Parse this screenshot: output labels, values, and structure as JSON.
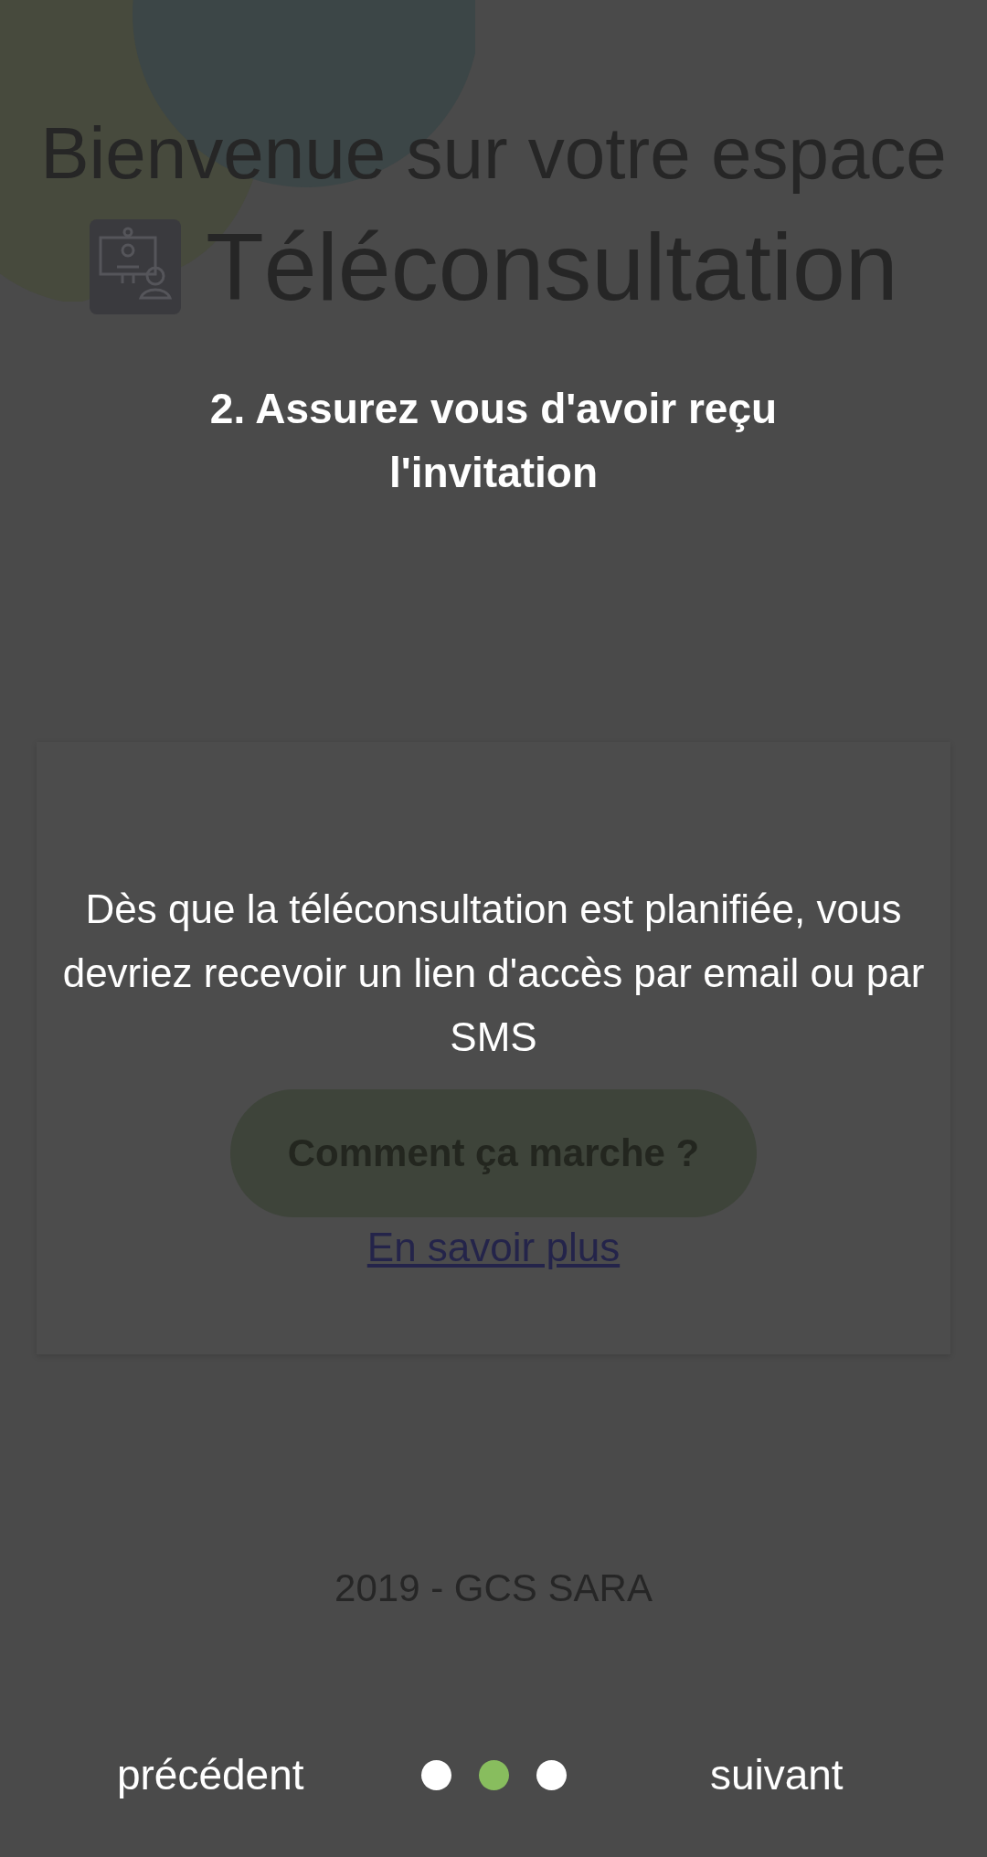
{
  "page": {
    "title": "Bienvenue sur votre espace",
    "brand": "Téléconsultation",
    "card": {
      "button": "Comment ça marche ?",
      "link": "En savoir plus"
    },
    "footer": "2019 - GCS SARA"
  },
  "tutorial": {
    "heading": "2. Assurez vous d'avoir reçu l'invitation",
    "body": "Dès que la téléconsultation est planifiée, vous devriez recevoir un lien d'accès par email ou par SMS",
    "previous": "précédent",
    "next": "suivant",
    "dots": [
      {
        "selected": false
      },
      {
        "selected": true
      },
      {
        "selected": false
      }
    ]
  }
}
